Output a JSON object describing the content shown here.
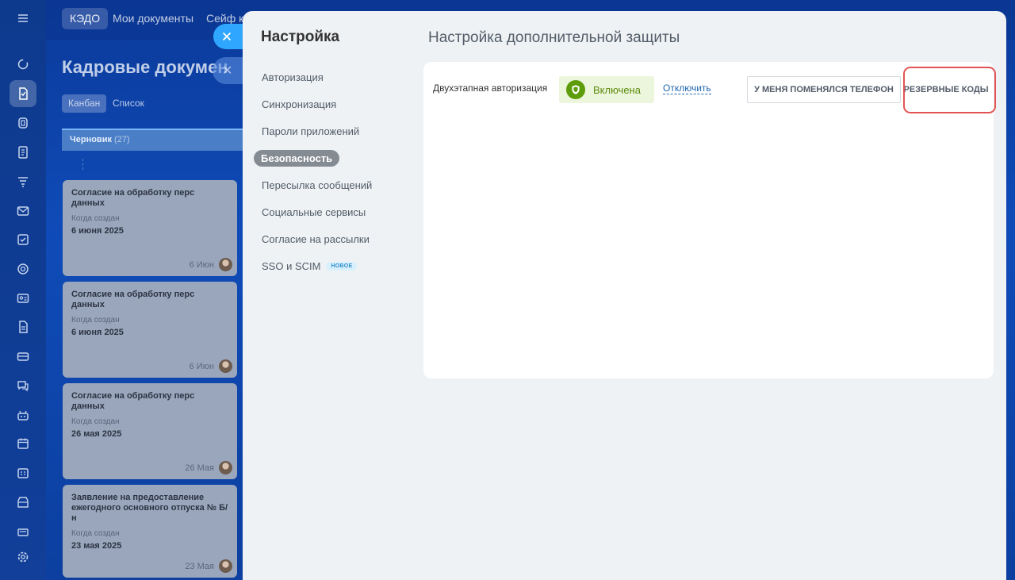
{
  "background": {
    "tabs": [
      "КЭДО",
      "Мои документы",
      "Сейф к"
    ],
    "page_title": "Кадровые докумен",
    "views": [
      "Канбан",
      "Список"
    ],
    "column": {
      "name": "Черновик",
      "count": "(27)"
    },
    "cards": [
      {
        "title": "Согласие на обработку перс данных",
        "label": "Когда создан",
        "date": "6 июня 2025",
        "foot": "6 Июн"
      },
      {
        "title": "Согласие на обработку перс данных",
        "label": "Когда создан",
        "date": "6 июня 2025",
        "foot": "6 Июн"
      },
      {
        "title": "Согласие на обработку перс данных",
        "label": "Когда создан",
        "date": "26 мая 2025",
        "foot": "26 Мая"
      },
      {
        "title": "Заявление на предоставление ежегодного основного отпуска № Б/н",
        "label": "Когда создан",
        "date": "23 мая 2025",
        "foot": "23 Мая"
      }
    ]
  },
  "rail": {
    "icons": [
      "menu-icon",
      "refresh-icon",
      "documents-icon",
      "contact-center-icon",
      "list-icon",
      "filter-icon",
      "mail-icon",
      "tasks-icon",
      "target-icon",
      "contacts-icon",
      "file-icon",
      "inbox-icon",
      "chat-icon",
      "robot-icon",
      "calendar-icon",
      "schedule-icon",
      "store-icon",
      "terminal-icon",
      "settings-icon"
    ],
    "active_index": 2
  },
  "panel": {
    "title": "Настройка",
    "menu": [
      {
        "label": "Авторизация",
        "active": false
      },
      {
        "label": "Синхронизация",
        "active": false
      },
      {
        "label": "Пароли приложений",
        "active": false
      },
      {
        "label": "Безопасность",
        "active": true
      },
      {
        "label": "Пересылка сообщений",
        "active": false
      },
      {
        "label": "Социальные сервисы",
        "active": false
      },
      {
        "label": "Согласие на рассылки",
        "active": false
      },
      {
        "label": "SSO и SCIM",
        "active": false,
        "badge": "НОВОЕ"
      }
    ],
    "content_title": "Настройка дополнительной защиты",
    "two_factor": {
      "label": "Двухэтапная авторизация",
      "status": "Включена",
      "disable_link": "Отключить",
      "phone_button": "У МЕНЯ ПОМЕНЯЛСЯ ТЕЛЕФОН",
      "codes_button": "РЕЗЕРВНЫЕ КОДЫ"
    }
  },
  "colors": {
    "accent": "#2fa6ff",
    "status_green": "#5d9c0a",
    "highlight": "#e25454",
    "link": "#2067b0"
  }
}
